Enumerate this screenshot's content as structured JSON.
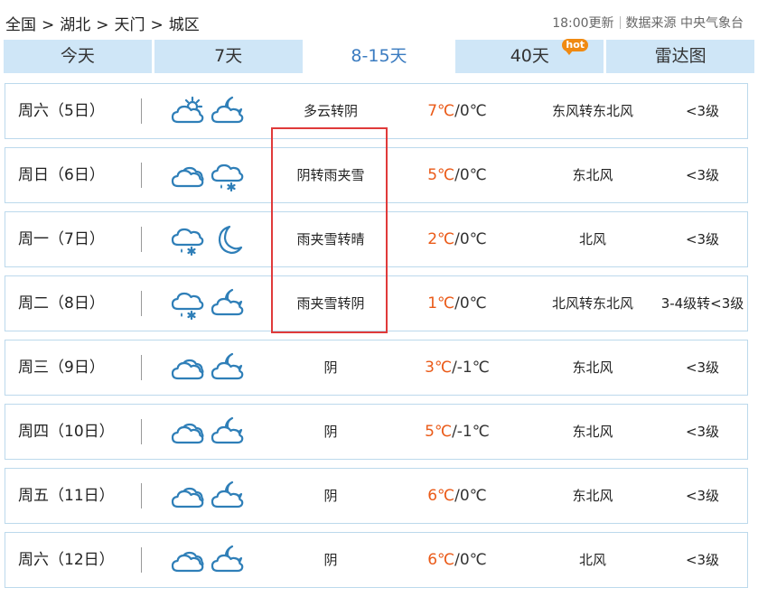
{
  "breadcrumb": [
    "全国",
    "湖北",
    "天门",
    "城区"
  ],
  "meta": {
    "updated": "18:00更新",
    "source": "数据来源 中央气象台"
  },
  "tabs": [
    {
      "label": "今天",
      "active": false
    },
    {
      "label": "7天",
      "active": false
    },
    {
      "label": "8-15天",
      "active": true
    },
    {
      "label": "40天",
      "active": false,
      "badge": "hot"
    },
    {
      "label": "雷达图",
      "active": false
    }
  ],
  "colors": {
    "accent": "#3a7bc0",
    "tab_bg": "#cfe6f7",
    "temp_high": "#ea5a18",
    "highlight": "#e03a3a",
    "hot_badge": "#f08a12"
  },
  "forecast": [
    {
      "date": "周六（5日）",
      "day_icon": "partly-cloudy-icon",
      "night_icon": "cloudy-moon-icon",
      "desc": "多云转阴",
      "high": "7℃",
      "low": "/0℃",
      "wind": "东风转东北风",
      "level": "<3级"
    },
    {
      "date": "周日（6日）",
      "day_icon": "overcast-icon",
      "night_icon": "sleet-icon",
      "desc": "阴转雨夹雪",
      "high": "5℃",
      "low": "/0℃",
      "wind": "东北风",
      "level": "<3级"
    },
    {
      "date": "周一（7日）",
      "day_icon": "sleet-icon",
      "night_icon": "moon-icon",
      "desc": "雨夹雪转晴",
      "high": "2℃",
      "low": "/0℃",
      "wind": "北风",
      "level": "<3级"
    },
    {
      "date": "周二（8日）",
      "day_icon": "sleet-icon",
      "night_icon": "cloudy-moon-icon",
      "desc": "雨夹雪转阴",
      "high": "1℃",
      "low": "/0℃",
      "wind": "北风转东北风",
      "level": "3-4级转<3级"
    },
    {
      "date": "周三（9日）",
      "day_icon": "overcast-icon",
      "night_icon": "cloudy-moon-icon",
      "desc": "阴",
      "high": "3℃",
      "low": "/-1℃",
      "wind": "东北风",
      "level": "<3级"
    },
    {
      "date": "周四（10日）",
      "day_icon": "overcast-icon",
      "night_icon": "cloudy-moon-icon",
      "desc": "阴",
      "high": "5℃",
      "low": "/-1℃",
      "wind": "东北风",
      "level": "<3级"
    },
    {
      "date": "周五（11日）",
      "day_icon": "overcast-icon",
      "night_icon": "cloudy-moon-icon",
      "desc": "阴",
      "high": "6℃",
      "low": "/0℃",
      "wind": "东北风",
      "level": "<3级"
    },
    {
      "date": "周六（12日）",
      "day_icon": "overcast-icon",
      "night_icon": "cloudy-moon-icon",
      "desc": "阴",
      "high": "6℃",
      "low": "/0℃",
      "wind": "北风",
      "level": "<3级"
    }
  ]
}
